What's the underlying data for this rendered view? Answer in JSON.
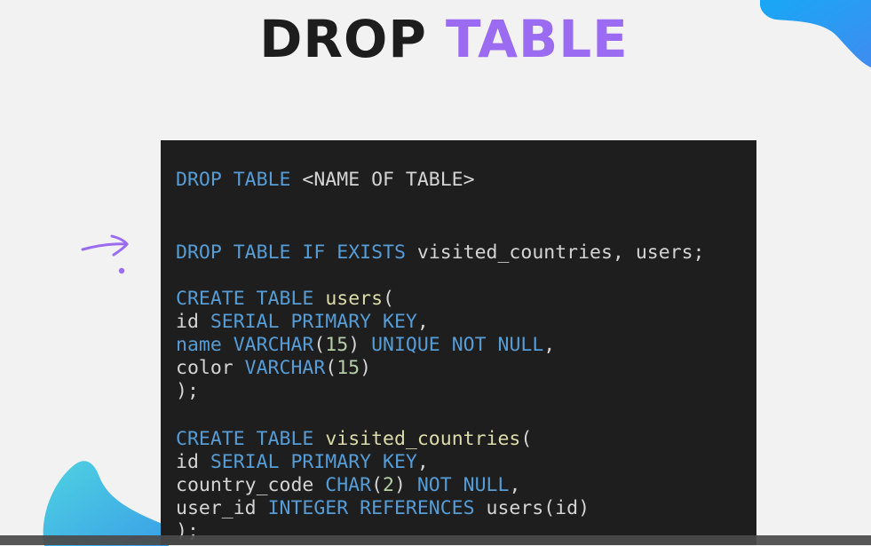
{
  "title": {
    "word1": "DROP",
    "word2": "TABLE"
  },
  "colors": {
    "background": "#f2f2f2",
    "title_dark": "#1d1d1d",
    "title_accent": "#9b6cf2",
    "code_background": "#1e1e1e",
    "keyword": "#569cd6",
    "identifier": "#dcdcaa",
    "number": "#b5cea8",
    "text": "#d4d4d4",
    "arrow": "#9b6cf2"
  },
  "code": {
    "lines": [
      [
        {
          "t": "kw",
          "v": "DROP"
        },
        {
          "t": "plain",
          "v": " "
        },
        {
          "t": "kw",
          "v": "TABLE"
        },
        {
          "t": "plain",
          "v": " <NAME OF TABLE>"
        }
      ],
      [],
      [],
      [
        {
          "t": "kw",
          "v": "DROP"
        },
        {
          "t": "plain",
          "v": " "
        },
        {
          "t": "kw",
          "v": "TABLE"
        },
        {
          "t": "plain",
          "v": " "
        },
        {
          "t": "kw",
          "v": "IF"
        },
        {
          "t": "plain",
          "v": " "
        },
        {
          "t": "kw",
          "v": "EXISTS"
        },
        {
          "t": "plain",
          "v": " visited_countries, users;"
        }
      ],
      [],
      [
        {
          "t": "kw",
          "v": "CREATE"
        },
        {
          "t": "plain",
          "v": " "
        },
        {
          "t": "kw",
          "v": "TABLE"
        },
        {
          "t": "plain",
          "v": " "
        },
        {
          "t": "fn",
          "v": "users"
        },
        {
          "t": "plain",
          "v": "("
        }
      ],
      [
        {
          "t": "plain",
          "v": "id "
        },
        {
          "t": "kw",
          "v": "SERIAL"
        },
        {
          "t": "plain",
          "v": " "
        },
        {
          "t": "kw",
          "v": "PRIMARY"
        },
        {
          "t": "plain",
          "v": " "
        },
        {
          "t": "kw",
          "v": "KEY"
        },
        {
          "t": "plain",
          "v": ","
        }
      ],
      [
        {
          "t": "kw",
          "v": "name"
        },
        {
          "t": "plain",
          "v": " "
        },
        {
          "t": "kw",
          "v": "VARCHAR"
        },
        {
          "t": "plain",
          "v": "("
        },
        {
          "t": "num",
          "v": "15"
        },
        {
          "t": "plain",
          "v": ") "
        },
        {
          "t": "kw",
          "v": "UNIQUE"
        },
        {
          "t": "plain",
          "v": " "
        },
        {
          "t": "kw",
          "v": "NOT"
        },
        {
          "t": "plain",
          "v": " "
        },
        {
          "t": "kw",
          "v": "NULL"
        },
        {
          "t": "plain",
          "v": ","
        }
      ],
      [
        {
          "t": "plain",
          "v": "color "
        },
        {
          "t": "kw",
          "v": "VARCHAR"
        },
        {
          "t": "plain",
          "v": "("
        },
        {
          "t": "num",
          "v": "15"
        },
        {
          "t": "plain",
          "v": ")"
        }
      ],
      [
        {
          "t": "plain",
          "v": ");"
        }
      ],
      [],
      [
        {
          "t": "kw",
          "v": "CREATE"
        },
        {
          "t": "plain",
          "v": " "
        },
        {
          "t": "kw",
          "v": "TABLE"
        },
        {
          "t": "plain",
          "v": " "
        },
        {
          "t": "fn",
          "v": "visited_countries"
        },
        {
          "t": "plain",
          "v": "("
        }
      ],
      [
        {
          "t": "plain",
          "v": "id "
        },
        {
          "t": "kw",
          "v": "SERIAL"
        },
        {
          "t": "plain",
          "v": " "
        },
        {
          "t": "kw",
          "v": "PRIMARY"
        },
        {
          "t": "plain",
          "v": " "
        },
        {
          "t": "kw",
          "v": "KEY"
        },
        {
          "t": "plain",
          "v": ","
        }
      ],
      [
        {
          "t": "plain",
          "v": "country_code "
        },
        {
          "t": "kw",
          "v": "CHAR"
        },
        {
          "t": "plain",
          "v": "("
        },
        {
          "t": "num",
          "v": "2"
        },
        {
          "t": "plain",
          "v": ") "
        },
        {
          "t": "kw",
          "v": "NOT"
        },
        {
          "t": "plain",
          "v": " "
        },
        {
          "t": "kw",
          "v": "NULL"
        },
        {
          "t": "plain",
          "v": ","
        }
      ],
      [
        {
          "t": "plain",
          "v": "user_id "
        },
        {
          "t": "kw",
          "v": "INTEGER"
        },
        {
          "t": "plain",
          "v": " "
        },
        {
          "t": "kw",
          "v": "REFERENCES"
        },
        {
          "t": "plain",
          "v": " users(id)"
        }
      ],
      [
        {
          "t": "plain",
          "v": ");"
        }
      ]
    ]
  }
}
